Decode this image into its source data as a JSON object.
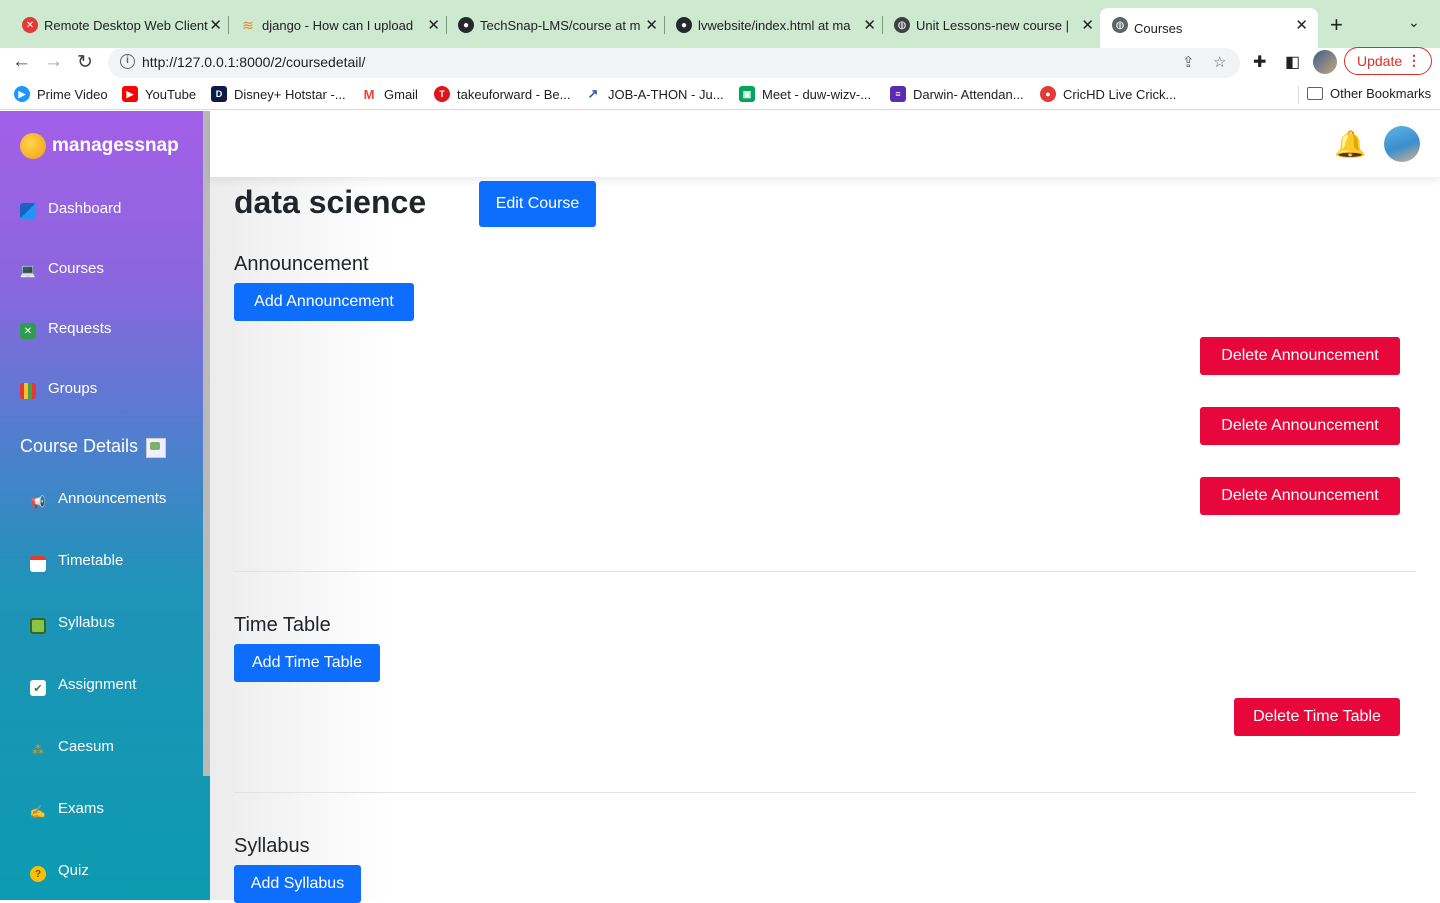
{
  "browser": {
    "tabs": [
      {
        "title": "Remote Desktop Web Client",
        "favicon": "remote-desktop-icon"
      },
      {
        "title": "django - How can I upload",
        "favicon": "stackoverflow-icon"
      },
      {
        "title": "TechSnap-LMS/course at m",
        "favicon": "github-icon"
      },
      {
        "title": "lvwebsite/index.html at ma",
        "favicon": "github-icon"
      },
      {
        "title": "Unit Lessons-new course |",
        "favicon": "globe-icon"
      },
      {
        "title": "Courses",
        "favicon": "globe-icon"
      }
    ],
    "url": "http://127.0.0.1:8000/2/coursedetail/",
    "update_label": "Update",
    "bookmarks": [
      {
        "label": "Prime Video"
      },
      {
        "label": "YouTube"
      },
      {
        "label": "Disney+ Hotstar -..."
      },
      {
        "label": "Gmail"
      },
      {
        "label": "takeuforward - Be..."
      },
      {
        "label": "JOB-A-THON - Ju..."
      },
      {
        "label": "Meet - duw-wizv-..."
      },
      {
        "label": "Darwin- Attendan..."
      },
      {
        "label": "CricHD Live Crick..."
      }
    ],
    "other_bookmarks": "Other Bookmarks"
  },
  "sidebar": {
    "brand": "managessnap",
    "items": [
      {
        "label": "Dashboard"
      },
      {
        "label": "Courses"
      },
      {
        "label": "Requests"
      },
      {
        "label": "Groups"
      }
    ],
    "section_title": "Course Details",
    "sub_items": [
      {
        "label": "Announcements"
      },
      {
        "label": "Timetable"
      },
      {
        "label": "Syllabus"
      },
      {
        "label": "Assignment"
      },
      {
        "label": "Caesum"
      },
      {
        "label": "Exams"
      },
      {
        "label": "Quiz"
      }
    ]
  },
  "main": {
    "course_title": "data science",
    "edit_course_label": "Edit Course",
    "announcement": {
      "heading": "Announcement",
      "add_label": "Add Announcement",
      "delete_label": "Delete Announcement"
    },
    "timetable": {
      "heading": "Time Table",
      "add_label": "Add Time Table",
      "delete_label": "Delete Time Table"
    },
    "syllabus": {
      "heading": "Syllabus",
      "add_label": "Add Syllabus"
    }
  },
  "colors": {
    "primary_button": "#0d6efd",
    "danger_button": "#e8073a",
    "tab_strip": "#cde9cf"
  }
}
